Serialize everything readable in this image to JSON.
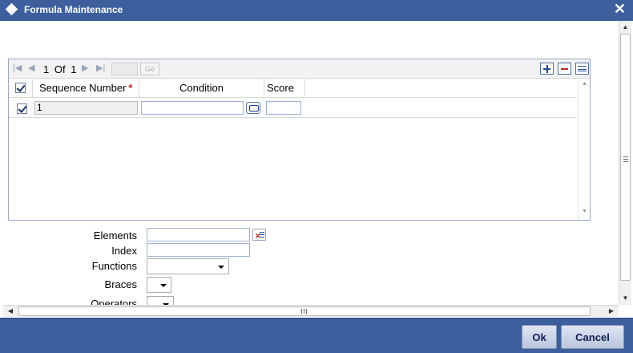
{
  "window": {
    "title": "Formula Maintenance",
    "close_symbol": "✕"
  },
  "grid": {
    "pagination": {
      "current": "1",
      "of_label": "Of",
      "total": "1",
      "go_label": "Go"
    },
    "columns": {
      "sequence_number": "Sequence Number",
      "required_mark": "*",
      "condition": "Condition",
      "score": "Score"
    },
    "rows": [
      {
        "checked": true,
        "sequence_number": "1",
        "condition": "",
        "score": ""
      }
    ]
  },
  "form": {
    "elements_label": "Elements",
    "index_label": "Index",
    "functions_label": "Functions",
    "braces_label": "Braces",
    "operators_label": "Operators"
  },
  "footer": {
    "ok_label": "Ok",
    "cancel_label": "Cancel"
  }
}
